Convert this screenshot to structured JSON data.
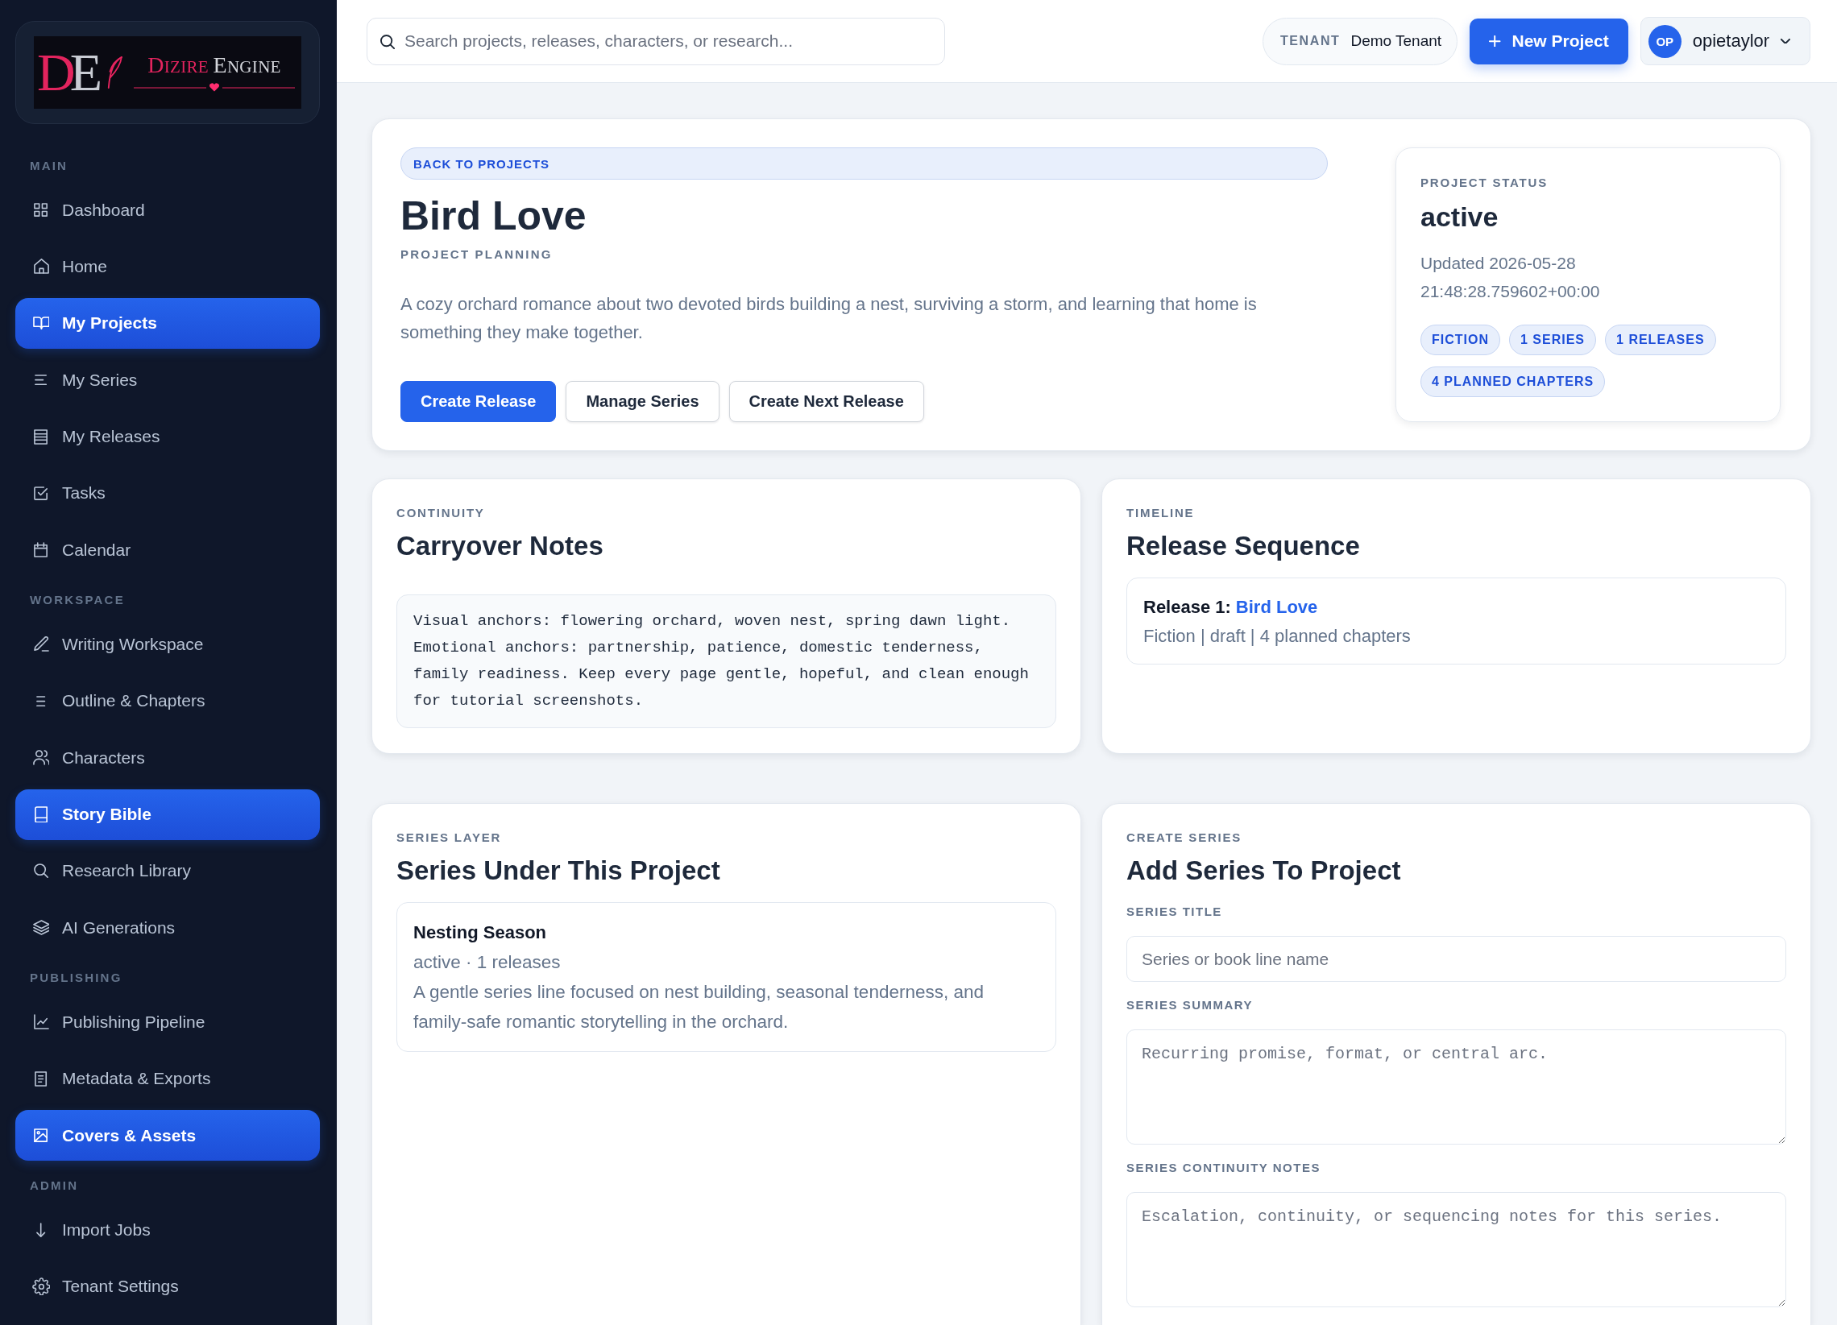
{
  "sidebar": {
    "logo": {
      "monogram": "DE",
      "words": [
        "DIZIRE",
        "ENGINE"
      ]
    },
    "sections": [
      {
        "label": "MAIN",
        "items": [
          {
            "label": "Dashboard",
            "selected": false
          },
          {
            "label": "Home",
            "selected": false
          },
          {
            "label": "My Projects",
            "selected": true
          },
          {
            "label": "My Series",
            "selected": false
          },
          {
            "label": "My Releases",
            "selected": false
          },
          {
            "label": "Tasks",
            "selected": false
          },
          {
            "label": "Calendar",
            "selected": false
          }
        ]
      },
      {
        "label": "WORKSPACE",
        "items": [
          {
            "label": "Writing Workspace",
            "selected": false
          },
          {
            "label": "Outline & Chapters",
            "selected": false
          },
          {
            "label": "Characters",
            "selected": false
          },
          {
            "label": "Story Bible",
            "selected": true
          },
          {
            "label": "Research Library",
            "selected": false
          },
          {
            "label": "AI Generations",
            "selected": false
          }
        ]
      },
      {
        "label": "PUBLISHING",
        "items": [
          {
            "label": "Publishing Pipeline",
            "selected": false
          },
          {
            "label": "Metadata & Exports",
            "selected": false
          },
          {
            "label": "Covers & Assets",
            "selected": true
          }
        ]
      },
      {
        "label": "ADMIN",
        "items": [
          {
            "label": "Import Jobs",
            "selected": false
          },
          {
            "label": "Tenant Settings",
            "selected": false
          }
        ]
      }
    ]
  },
  "topbar": {
    "search": {
      "placeholder": "Search projects, releases, characters, or research..."
    },
    "tenant": {
      "label": "TENANT",
      "value": "Demo Tenant"
    },
    "new_project_button": {
      "label": "New Project"
    },
    "user": {
      "initials": "OP",
      "name": "opietaylor"
    }
  },
  "project": {
    "back_link": "BACK TO PROJECTS",
    "title": "Bird Love",
    "subtitle": "PROJECT PLANNING",
    "description": "A cozy orchard romance about two devoted birds building a nest, surviving a storm, and learning that home is something they make together.",
    "buttons": [
      {
        "label": "Create Release",
        "kind": "primary"
      },
      {
        "label": "Manage Series",
        "kind": "secondary"
      },
      {
        "label": "Create Next Release",
        "kind": "secondary"
      }
    ],
    "status_card": {
      "label": "PROJECT STATUS",
      "status": "active",
      "updated": "Updated 2026-05-28 21:48:28.759602+00:00",
      "tags": [
        "FICTION",
        "1 SERIES",
        "1 RELEASES",
        "4 PLANNED CHAPTERS"
      ]
    }
  },
  "continuity": {
    "eyebrow": "CONTINUITY",
    "title": "Carryover Notes",
    "notes": "Visual anchors: flowering orchard, woven nest, spring dawn light. Emotional anchors: partnership, patience, domestic tenderness, family readiness. Keep every page gentle, hopeful, and clean enough for tutorial screenshots."
  },
  "timeline": {
    "eyebrow": "TIMELINE",
    "title": "Release Sequence",
    "releases": [
      {
        "number": "Release 1:",
        "title": "Bird Love",
        "meta": "Fiction | draft | 4 planned chapters"
      }
    ]
  },
  "series_layer": {
    "eyebrow": "SERIES LAYER",
    "title": "Series Under This Project",
    "series": [
      {
        "name": "Nesting Season",
        "meta": "active · 1 releases",
        "description": "A gentle series line focused on nest building, seasonal tenderness, and family-safe romantic storytelling in the orchard."
      }
    ]
  },
  "create_series": {
    "eyebrow": "CREATE SERIES",
    "title": "Add Series To Project",
    "fields": [
      {
        "label": "SERIES TITLE",
        "kind": "input",
        "placeholder": "Series or book line name"
      },
      {
        "label": "SERIES SUMMARY",
        "kind": "textarea",
        "placeholder": "Recurring promise, format, or central arc."
      },
      {
        "label": "SERIES CONTINUITY NOTES",
        "kind": "textarea",
        "placeholder": "Escalation, continuity, or sequencing notes for this series."
      }
    ]
  }
}
